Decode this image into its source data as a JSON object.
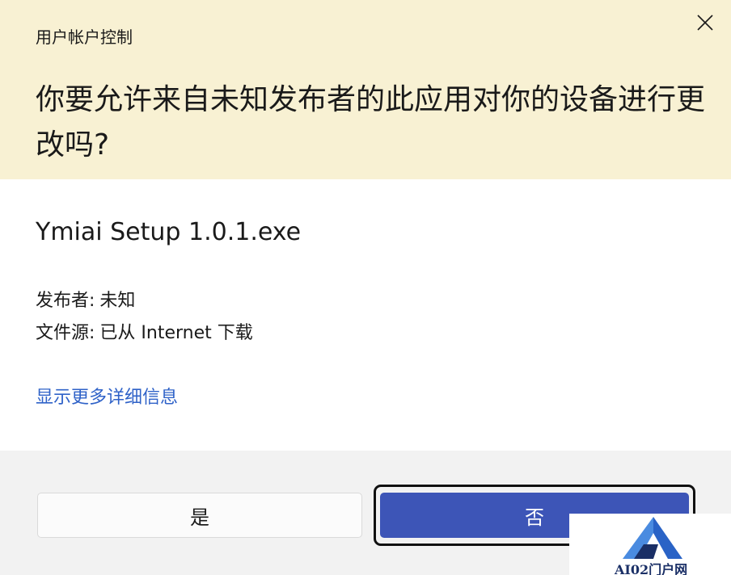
{
  "dialog": {
    "window_title": "用户帐户控制",
    "heading": "你要允许来自未知发布者的此应用对你的设备进行更改吗?",
    "program_name": "Ymiai Setup 1.0.1.exe",
    "publisher_label": "发布者:",
    "publisher_value": "未知",
    "origin_label": "文件源:",
    "origin_value": "已从 Internet 下载",
    "details_link": "显示更多详细信息",
    "yes_label": "是",
    "no_label": "否"
  },
  "watermark": {
    "text": "AI02门户网"
  },
  "colors": {
    "header_bg": "#f8f1d3",
    "footer_bg": "#f2f2f2",
    "link": "#2f62c8",
    "primary_button": "#3d55b7"
  },
  "icons": {
    "close": "close-icon",
    "logo": "ai-logo"
  }
}
